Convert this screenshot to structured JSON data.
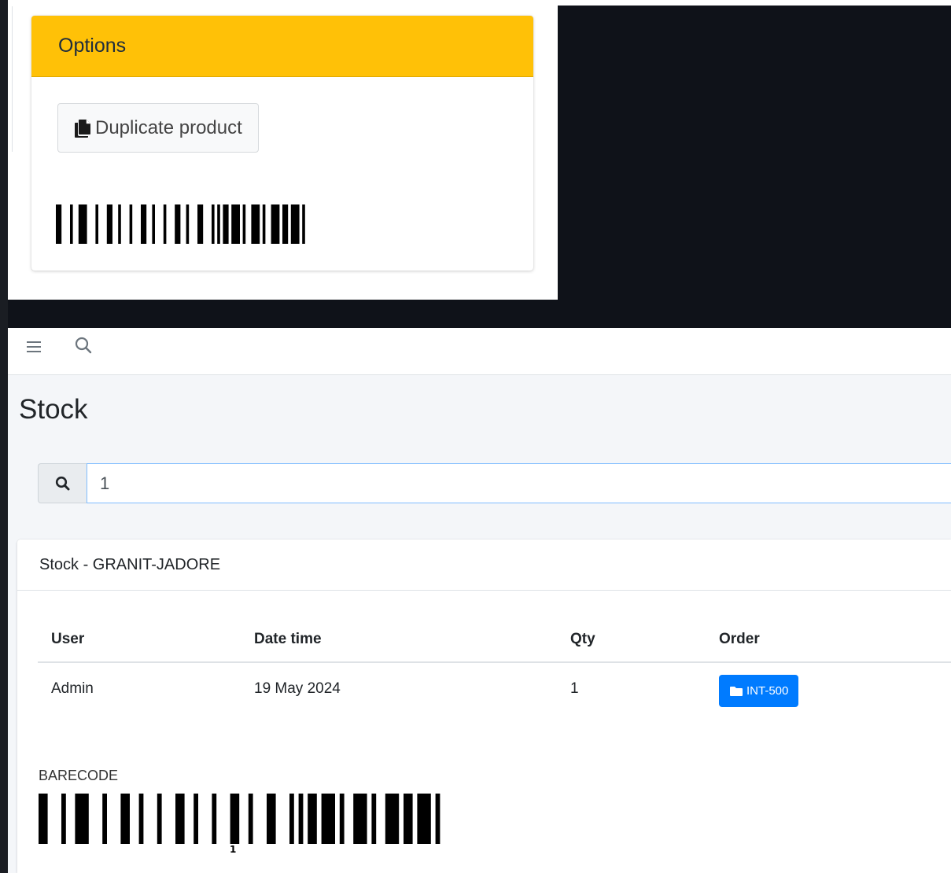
{
  "options_card": {
    "title": "Options",
    "duplicate_button_label": "Duplicate product",
    "duplicate_icon": "copy-icon"
  },
  "navbar": {
    "menu_icon": "hamburger-menu-icon",
    "search_icon": "search-icon"
  },
  "page": {
    "title": "Stock"
  },
  "search": {
    "icon": "search-icon",
    "value": "1"
  },
  "stock_card": {
    "title": "Stock - GRANIT-JADORE",
    "columns": [
      "User",
      "Date time",
      "Qty",
      "Order"
    ],
    "rows": [
      {
        "user": "Admin",
        "date_time": "19 May 2024",
        "qty": "1",
        "order": "INT-500",
        "order_icon": "folder-icon"
      }
    ],
    "barcode_label": "BARECODE",
    "barcode_digit": "1"
  },
  "colors": {
    "options_header": "#ffc107",
    "order_badge": "#007bff",
    "dark_background": "#0f1219"
  }
}
